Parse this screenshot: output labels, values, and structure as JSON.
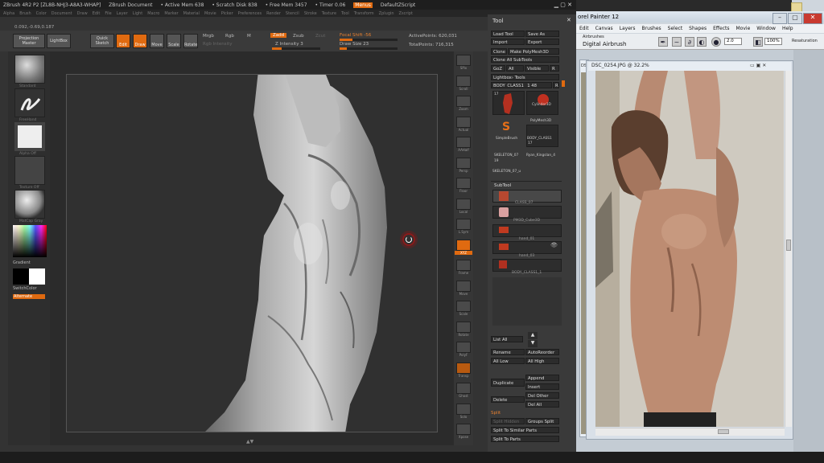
{
  "zbrush": {
    "title": "ZBrush 4R2 P2 [ZL8B-NHJ3-A8A3-WHAP]",
    "document_label": "ZBrush Document",
    "active_mem": "• Active Mem 638",
    "scratch_disk": "• Scratch Disk 838",
    "free_mem": "• Free Mem 3457",
    "timer": "• Timer 0.06",
    "menus_btn": "Menus",
    "script": "DefaultZScript",
    "menu_items": [
      "Alpha",
      "Brush",
      "Color",
      "Document",
      "Draw",
      "Edit",
      "File",
      "Layer",
      "Light",
      "Macro",
      "Marker",
      "Material",
      "Movie",
      "Picker",
      "Preferences",
      "Render",
      "Stencil",
      "Stroke",
      "Texture",
      "Tool",
      "Transform",
      "Zplugin",
      "Zscript"
    ],
    "coords": "0.092,-0.69,0.187",
    "shelf": {
      "projection_master": "Projection Master",
      "lightbox": "LightBox",
      "quick_sketch": "Quick Sketch",
      "edit": "Edit",
      "draw": "Draw",
      "move": "Move",
      "scale": "Scale",
      "rotate": "Rotate",
      "mrgb": "Mrgb",
      "rgb": "Rgb",
      "m": "M",
      "rgb_intensity": "Rgb Intensity",
      "zadd": "Zadd",
      "zsub": "Zsub",
      "zcut": "Zcut",
      "z_intensity": "Z Intensity 3",
      "focal_shift": "Focal Shift -56",
      "draw_size": "Draw Size 23",
      "active_points": "ActivePoints: 620,031",
      "total_points": "TotalPoints: 716,315"
    },
    "left_tray": {
      "brush_label": "Standard",
      "stroke_label": "FreeHand",
      "alpha_label": "Alpha Off",
      "texture_label": "Texture Off",
      "material_label": "MatCap Gray",
      "gradient": "Gradient",
      "switch_color": "SwitchColor",
      "alternate": "Alternate"
    },
    "right_shelf": [
      "SPix",
      "Scroll",
      "Zoom",
      "Actual",
      "AAHalf",
      "Persp",
      "Floor",
      "Local",
      "L.Sym",
      "XYZ",
      "Frame",
      "Move",
      "Scale",
      "Rotate",
      "PolyF",
      "Transp",
      "Ghost",
      "Solo",
      "Xpose"
    ],
    "tool": {
      "header": "Tool",
      "load_tool": "Load Tool",
      "save_as": "Save As",
      "import": "Import",
      "export": "Export",
      "clone": "Clone",
      "make_polymesh": "Make PolyMesh3D",
      "clone_all": "Clone All SubTools",
      "goz": "GoZ",
      "all": "All",
      "visible": "Visible",
      "r": "R",
      "lightbox_tools": "Lightbox› Tools",
      "current": "BODY_CLASS1_ 1 48",
      "cells": [
        "BODY_CLASS1",
        "Cylinder3D",
        "PolyMesh3D",
        "SimpleBrush",
        "BODY_CLASS1",
        "SKELETON_07",
        "Ryan_Kingslan_4",
        "SKELETON_07_u"
      ],
      "cell_counts": [
        "17",
        "17",
        "19",
        "19"
      ],
      "subtool_header": "SubTool",
      "subtools": [
        "BODY_CLASS1",
        "CLASS_07",
        "PM3D_Cube3D",
        "hand_01",
        "hand_03",
        "BODY_CLASS1_1"
      ],
      "list_all": "List All",
      "rename": "Rename",
      "auto_reorder": "AutoReorder",
      "all_low": "All Low",
      "all_high": "All High",
      "duplicate": "Duplicate",
      "append": "Append",
      "insert": "Insert",
      "delete": "Delete",
      "del_other": "Del Other",
      "del_all": "Del All",
      "split": "Split",
      "split_hidden": "Split Hidden",
      "groups_split": "Groups Split",
      "split_similar": "Split To Similar Parts",
      "split_parts": "Split To Parts"
    }
  },
  "painter": {
    "title": "orel Painter 12",
    "menu": [
      "Edit",
      "Canvas",
      "Layers",
      "Brushes",
      "Select",
      "Shapes",
      "Effects",
      "Movie",
      "Window",
      "Help"
    ],
    "brush_category": "Airbrushes",
    "brush_variant": "Digital Airbrush",
    "size": "2.0",
    "opacity": "100%",
    "resaturation": "Resaturation",
    "doc_title": "DSC_0254.JPG @ 32.2%",
    "doc2_prefix": "DS"
  }
}
